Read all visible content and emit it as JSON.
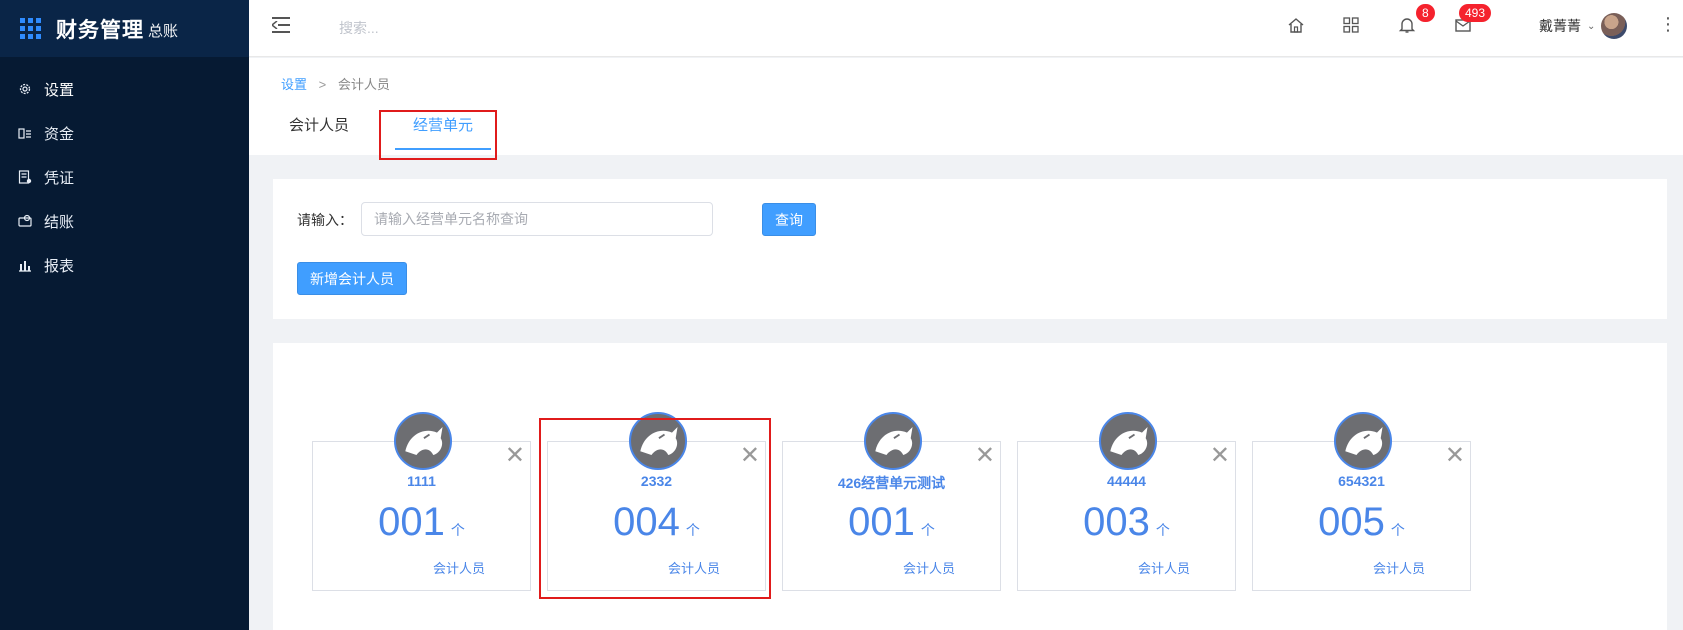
{
  "sidebar": {
    "brand_title": "财务管理",
    "brand_sub": "总账",
    "items": [
      {
        "label": "设置",
        "icon": "gear-icon"
      },
      {
        "label": "资金",
        "icon": "funds-icon"
      },
      {
        "label": "凭证",
        "icon": "voucher-icon"
      },
      {
        "label": "结账",
        "icon": "checkout-icon"
      },
      {
        "label": "报表",
        "icon": "report-icon"
      }
    ]
  },
  "header": {
    "search_placeholder": "搜索...",
    "notification_count": "8",
    "message_count": "493",
    "user_name": "戴菁菁"
  },
  "breadcrumb": {
    "root": "设置",
    "separator": ">",
    "current": "会计人员"
  },
  "tabs": [
    {
      "label": "会计人员"
    },
    {
      "label": "经营单元"
    }
  ],
  "search": {
    "label": "请输入：",
    "placeholder": "请输入经营单元名称查询",
    "query_button": "查询",
    "add_button": "新增会计人员"
  },
  "cards": [
    {
      "name": "1111",
      "count": "001",
      "unit": "个",
      "role": "会计人员"
    },
    {
      "name": "2332",
      "count": "004",
      "unit": "个",
      "role": "会计人员"
    },
    {
      "name": "426经营单元测试",
      "count": "001",
      "unit": "个",
      "role": "会计人员"
    },
    {
      "name": "44444",
      "count": "003",
      "unit": "个",
      "role": "会计人员"
    },
    {
      "name": "654321",
      "count": "005",
      "unit": "个",
      "role": "会计人员"
    }
  ],
  "colors": {
    "sidebar_bg": "#061a33",
    "accent": "#409eff",
    "card_text": "#4a86e8",
    "highlight": "#e01b1b",
    "badge": "#f5222d"
  }
}
